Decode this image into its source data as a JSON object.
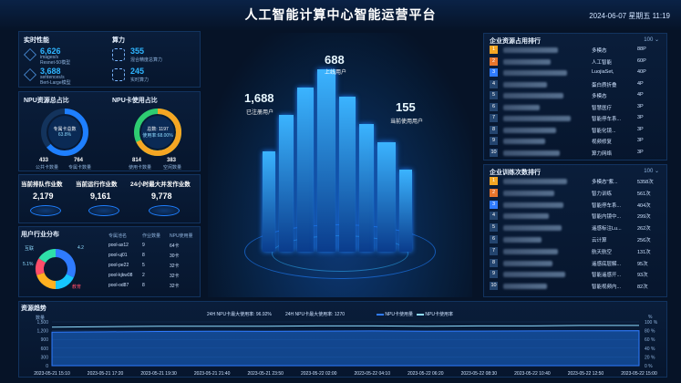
{
  "header": {
    "title": "人工智能计算中心智能运营平台",
    "datetime": "2024-06-07 星期五 11:19"
  },
  "compute": {
    "perf_title": "实时性能",
    "perf": [
      {
        "value": "6,626",
        "unit": "images/s",
        "sub": "Resnet-50模型"
      },
      {
        "value": "3,688",
        "unit": "sentences/s",
        "sub": "Bert-Large模型"
      }
    ],
    "power_title": "算力",
    "power": [
      {
        "value": "355",
        "sub": "混合精度总算力"
      },
      {
        "value": "245",
        "sub": "实时算力"
      }
    ]
  },
  "npu_res": {
    "title": "NPU资源总占比",
    "center_label": "专属卡总数",
    "center_pct": "63.8%",
    "a_value": "433",
    "b_value": "764",
    "a_label": "公共卡数量",
    "b_label": "专属卡数量",
    "ratio": 0.638
  },
  "npu_use": {
    "title": "NPU卡使用占比",
    "center_label": "总数: 1197",
    "center_pct": "使用率:68.00%",
    "a_value": "814",
    "b_value": "383",
    "a_label": "使用卡数量",
    "b_label": "空闲数量",
    "ratio": 0.68
  },
  "jobs": [
    {
      "label": "当前排队作业数",
      "value": "2,179"
    },
    {
      "label": "当前运行作业数",
      "value": "9,161"
    },
    {
      "label": "24小时最大并发作业数",
      "value": "9,778"
    }
  ],
  "industry": {
    "title": "用户行业分布",
    "legend": [
      "互联",
      "4.2",
      "5.1%",
      "教育"
    ],
    "headers": [
      "专属池名",
      "作业数量",
      "NPU使用量"
    ],
    "rows": [
      [
        "pool-ax12",
        "9",
        "64卡"
      ],
      [
        "pool-uj01",
        "8",
        "30卡"
      ],
      [
        "pool-pe22",
        "5",
        "32卡"
      ],
      [
        "pool-kjkw08",
        "2",
        "32卡"
      ],
      [
        "pool-od87",
        "8",
        "32卡"
      ]
    ],
    "slices": [
      {
        "value": 0.32,
        "color": "#2f7bff"
      },
      {
        "value": 0.18,
        "color": "#15c6ff"
      },
      {
        "value": 0.2,
        "color": "#ffb020"
      },
      {
        "value": 0.14,
        "color": "#ff4d6a"
      },
      {
        "value": 0.16,
        "color": "#2ee0a8"
      }
    ]
  },
  "center": {
    "users_active": "688",
    "users_active_label": "上线用户",
    "users_reg": "1,688",
    "users_reg_label": "已注册用户",
    "users_now": "155",
    "users_now_label": "当前使用用户"
  },
  "rank1": {
    "title": "企业资源占用排行",
    "dropdown": "100",
    "rows": [
      {
        "rank": "1",
        "dept": "多模态",
        "val": "88P",
        "w": 60
      },
      {
        "rank": "2",
        "dept": "人工智能",
        "val": "60P",
        "w": 52
      },
      {
        "rank": "3",
        "dept": "LuojiaSet,",
        "val": "40P",
        "w": 70
      },
      {
        "rank": "4",
        "dept": "蛋白质折叠",
        "val": "4P",
        "w": 48
      },
      {
        "rank": "5",
        "dept": "多模态",
        "val": "4P",
        "w": 66
      },
      {
        "rank": "6",
        "dept": "智慧医疗",
        "val": "3P",
        "w": 40
      },
      {
        "rank": "7",
        "dept": "智能停车系...",
        "val": "3P",
        "w": 74
      },
      {
        "rank": "8",
        "dept": "智能化镜...",
        "val": "3P",
        "w": 58
      },
      {
        "rank": "9",
        "dept": "视频修复",
        "val": "3P",
        "w": 46
      },
      {
        "rank": "10",
        "dept": "算力网络",
        "val": "3P",
        "w": 62
      }
    ]
  },
  "rank2": {
    "title": "企业训练次数排行",
    "dropdown": "100",
    "rows": [
      {
        "rank": "1",
        "dept": "多模态\"紫...",
        "val": "5358次",
        "w": 70
      },
      {
        "rank": "2",
        "dept": "智力训练",
        "val": "561次",
        "w": 56
      },
      {
        "rank": "3",
        "dept": "智能停车系...",
        "val": "404次",
        "w": 66
      },
      {
        "rank": "4",
        "dept": "智能内镜中...",
        "val": "299次",
        "w": 50
      },
      {
        "rank": "5",
        "dept": "遥感标注Lu...",
        "val": "262次",
        "w": 64
      },
      {
        "rank": "6",
        "dept": "云计算",
        "val": "256次",
        "w": 42
      },
      {
        "rank": "7",
        "dept": "航天航空",
        "val": "131次",
        "w": 60
      },
      {
        "rank": "8",
        "dept": "遥感底层解...",
        "val": "95次",
        "w": 54
      },
      {
        "rank": "9",
        "dept": "智能遥感开...",
        "val": "93次",
        "w": 68
      },
      {
        "rank": "10",
        "dept": "智能视频内...",
        "val": "82次",
        "w": 48
      }
    ]
  },
  "trend": {
    "title": "资源趋势",
    "peak1": "24H NPU卡最大使用率: 96.92%",
    "peak2": "24H NPU卡最大使用率: 1270",
    "legend1": "NPU卡使用量",
    "legend2": "NPU卡使用率",
    "yleft_label": "数量",
    "yright_label": "%",
    "yleft": [
      "1,500",
      "1,200",
      "900",
      "600",
      "300",
      "0"
    ],
    "yright": [
      "100 %",
      "80 %",
      "60 %",
      "40 %",
      "20 %",
      "0 %"
    ]
  },
  "chart_data": {
    "type": "area",
    "x": [
      "2023-05-21 15:10",
      "2023-05-21 17:20",
      "2023-05-21 19:30",
      "2023-05-21 21:40",
      "2023-05-21 23:50",
      "2023-05-22 02:00",
      "2023-05-22 04:10",
      "2023-05-22 06:20",
      "2023-05-22 08:30",
      "2023-05-22 10:40",
      "2023-05-22 12:50",
      "2023-05-22 15:00"
    ],
    "series": [
      {
        "name": "NPU卡使用量",
        "values": [
          1150,
          1160,
          1170,
          1180,
          1175,
          1185,
          1190,
          1180,
          1185,
          1190,
          1195,
          1200
        ]
      },
      {
        "name": "NPU卡使用率",
        "values": [
          88,
          89,
          90,
          90,
          90,
          91,
          91,
          90,
          91,
          91,
          92,
          92
        ]
      }
    ],
    "ylim": [
      0,
      1500
    ],
    "y2lim": [
      0,
      100
    ]
  },
  "colors": {
    "accent": "#2fb5ff",
    "rank_gold": "#f5a623",
    "rank_silver": "#e8752c",
    "rank_bronze": "#2f7bff",
    "rank_default": "#23446e"
  }
}
